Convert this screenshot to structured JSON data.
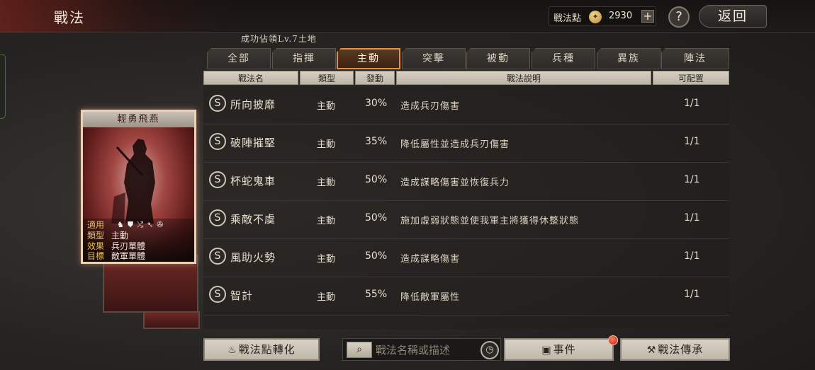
{
  "header": {
    "title": "戰法",
    "points_label": "戰法點",
    "points_icon": "coin-icon",
    "points_value": "2930",
    "add_label": "+",
    "help_label": "?",
    "back_label": "返回"
  },
  "notice": "成功佔領Lv.7土地",
  "tabs": [
    {
      "label": "全部",
      "active": false
    },
    {
      "label": "指揮",
      "active": false
    },
    {
      "label": "主動",
      "active": true
    },
    {
      "label": "突擊",
      "active": false
    },
    {
      "label": "被動",
      "active": false
    },
    {
      "label": "兵種",
      "active": false
    },
    {
      "label": "異族",
      "active": false
    },
    {
      "label": "陣法",
      "active": false
    }
  ],
  "columns": {
    "name": "戰法名",
    "type": "類型",
    "rate": "發動",
    "desc": "戰法說明",
    "alloc": "可配置"
  },
  "rows": [
    {
      "grade": "S",
      "name": "所向披靡",
      "type": "主動",
      "rate": "30%",
      "desc": "造成兵刃傷害",
      "alloc": "1/1"
    },
    {
      "grade": "S",
      "name": "破陣摧堅",
      "type": "主動",
      "rate": "35%",
      "desc": "降低屬性並造成兵刃傷害",
      "alloc": "1/1"
    },
    {
      "grade": "S",
      "name": "杯蛇鬼車",
      "type": "主動",
      "rate": "50%",
      "desc": "造成謀略傷害並恢復兵力",
      "alloc": "1/1"
    },
    {
      "grade": "S",
      "name": "乘敵不虞",
      "type": "主動",
      "rate": "50%",
      "desc": "施加虛弱狀態並使我軍主將獲得休整狀態",
      "alloc": "1/1"
    },
    {
      "grade": "S",
      "name": "風助火勢",
      "type": "主動",
      "rate": "50%",
      "desc": "造成謀略傷害",
      "alloc": "1/1"
    },
    {
      "grade": "S",
      "name": "智計",
      "type": "主動",
      "rate": "55%",
      "desc": "降低敵軍屬性",
      "alloc": "1/1"
    }
  ],
  "card": {
    "title": "輕勇飛燕",
    "applies_label": "適用",
    "applies_icons": [
      "cavalry-icon",
      "shield-icon",
      "bow-icon",
      "spear-icon",
      "wheel-icon"
    ],
    "type_label": "類型",
    "type_value": "主動",
    "effect_label": "效果",
    "effect_value": "兵刃單體",
    "target_label": "目標",
    "target_value": "敵軍單體"
  },
  "bottom": {
    "convert_label": "戰法點轉化",
    "search_placeholder": "戰法名稱或描述",
    "event_label": "事件",
    "inherit_label": "戰法傳承"
  },
  "colors": {
    "accent_tab": "#e39140",
    "card_border": "#ead2b8",
    "notification": "#d2402b"
  }
}
